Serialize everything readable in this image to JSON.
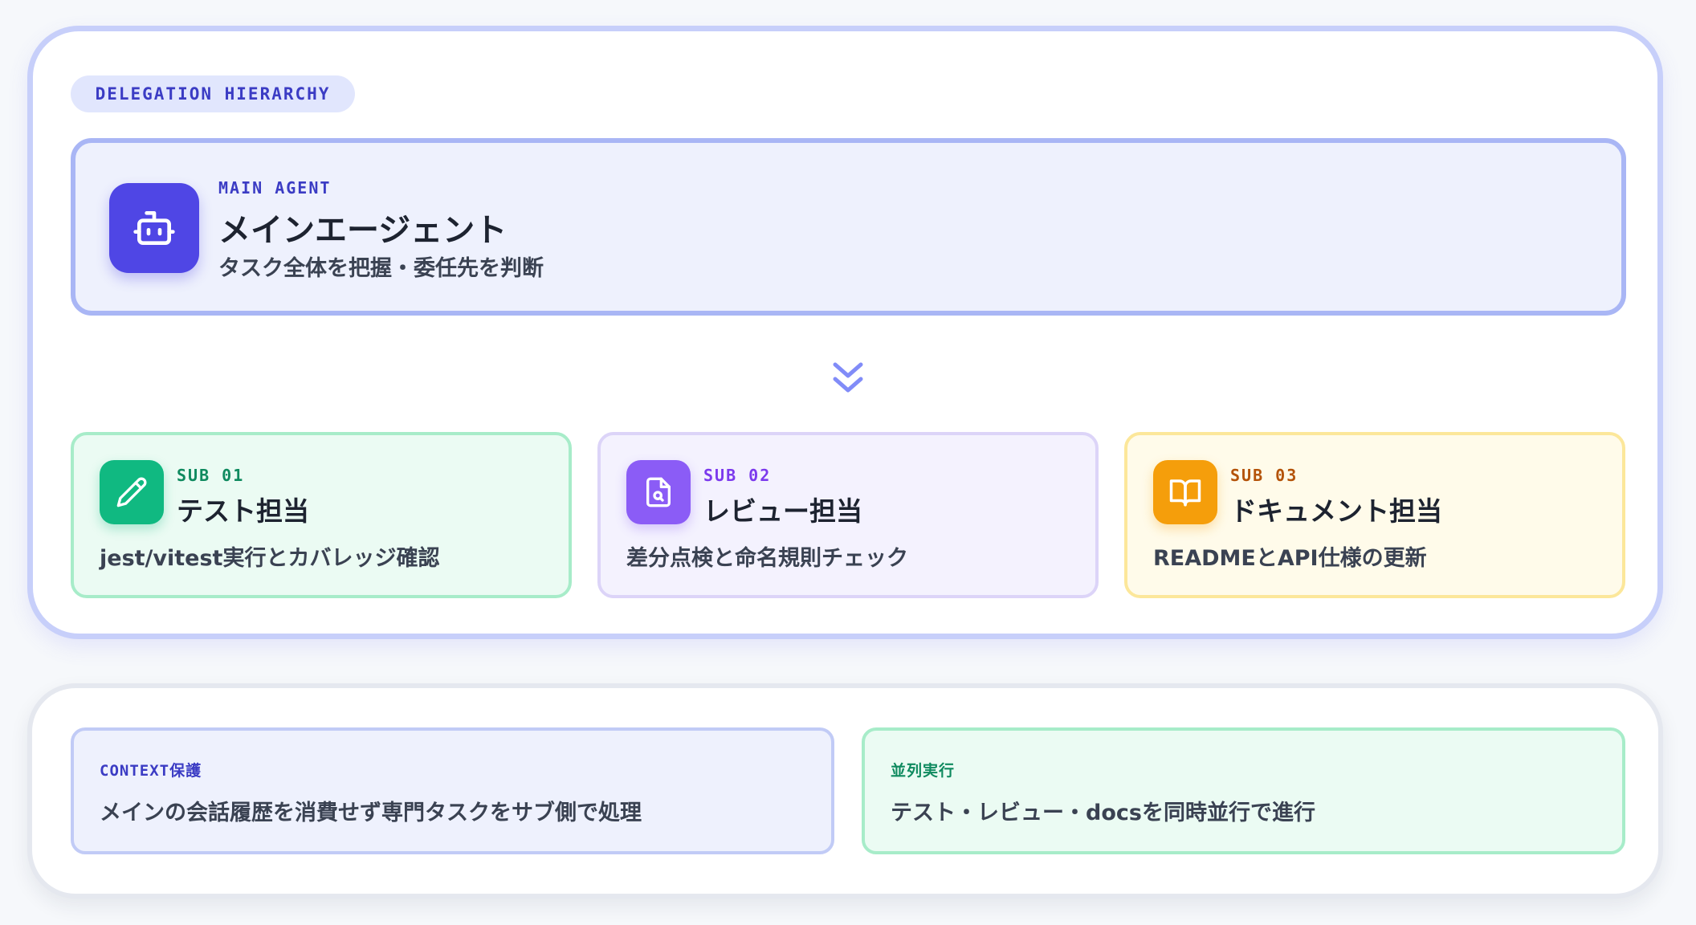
{
  "header": {
    "pill": "DELEGATION HIERARCHY"
  },
  "main_agent": {
    "eyebrow": "MAIN AGENT",
    "title": "メインエージェント",
    "subtitle": "タスク全体を把握・委任先を判断",
    "icon": "robot-icon",
    "accent": "#4f46e5"
  },
  "subagents": [
    {
      "eyebrow": "SUB 01",
      "title": "テスト担当",
      "description": "jest/vitest実行とカバレッジ確認",
      "icon": "pencil-icon",
      "accent": "#10b981"
    },
    {
      "eyebrow": "SUB 02",
      "title": "レビュー担当",
      "description": "差分点検と命名規則チェック",
      "icon": "file-search-icon",
      "accent": "#8b5cf6"
    },
    {
      "eyebrow": "SUB 03",
      "title": "ドキュメント担当",
      "description": "READMEとAPI仕様の更新",
      "icon": "book-open-icon",
      "accent": "#f59e0b"
    }
  ],
  "benefits": [
    {
      "label": "CONTEXT保護",
      "text": "メインの会話履歴を消費せず専門タスクをサブ側で処理"
    },
    {
      "label": "並列実行",
      "text": "テスト・レビュー・docsを同時並行で進行"
    }
  ]
}
